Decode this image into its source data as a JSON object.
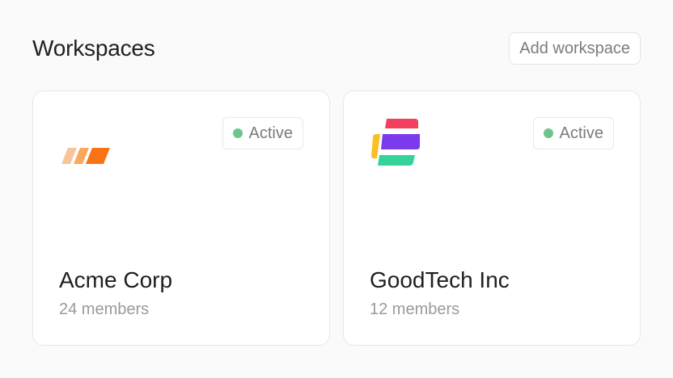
{
  "header": {
    "title": "Workspaces",
    "add_label": "Add workspace"
  },
  "colors": {
    "status_active": "#6ec48d",
    "acme_logo": [
      "#f9c49a",
      "#fba85e",
      "#f97316"
    ],
    "goodtech_logo": [
      "#f43f5e",
      "#fbbf24",
      "#7c3aed",
      "#34d399"
    ]
  },
  "workspaces": [
    {
      "name": "Acme Corp",
      "members": "24 members",
      "status": "Active",
      "logo_icon": "acme-stripes-logo"
    },
    {
      "name": "GoodTech Inc",
      "members": "12 members",
      "status": "Active",
      "logo_icon": "goodtech-g-logo"
    }
  ]
}
